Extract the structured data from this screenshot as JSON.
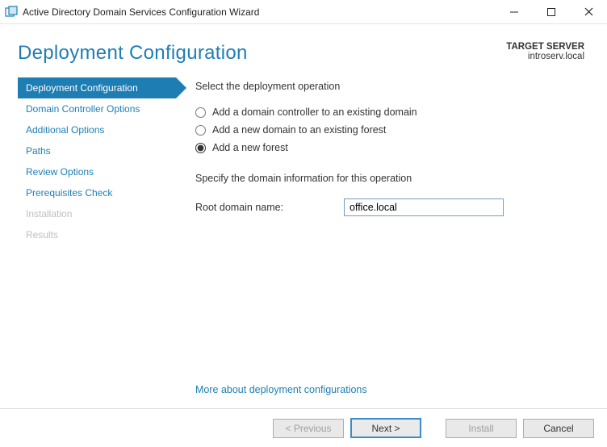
{
  "window": {
    "title": "Active Directory Domain Services Configuration Wizard"
  },
  "header": {
    "title": "Deployment Configuration",
    "target_label": "TARGET SERVER",
    "target_value": "introserv.local"
  },
  "sidebar": {
    "steps": [
      {
        "label": "Deployment Configuration",
        "state": "active"
      },
      {
        "label": "Domain Controller Options",
        "state": "normal"
      },
      {
        "label": "Additional Options",
        "state": "normal"
      },
      {
        "label": "Paths",
        "state": "normal"
      },
      {
        "label": "Review Options",
        "state": "normal"
      },
      {
        "label": "Prerequisites Check",
        "state": "normal"
      },
      {
        "label": "Installation",
        "state": "disabled"
      },
      {
        "label": "Results",
        "state": "disabled"
      }
    ]
  },
  "content": {
    "select_label": "Select the deployment operation",
    "radios": [
      {
        "label": "Add a domain controller to an existing domain",
        "checked": false
      },
      {
        "label": "Add a new domain to an existing forest",
        "checked": false
      },
      {
        "label": "Add a new forest",
        "checked": true
      }
    ],
    "spec_label": "Specify the domain information for this operation",
    "root_domain_label": "Root domain name:",
    "root_domain_value": "office.local",
    "more_link": "More about deployment configurations"
  },
  "footer": {
    "previous": "< Previous",
    "next": "Next >",
    "install": "Install",
    "cancel": "Cancel"
  }
}
